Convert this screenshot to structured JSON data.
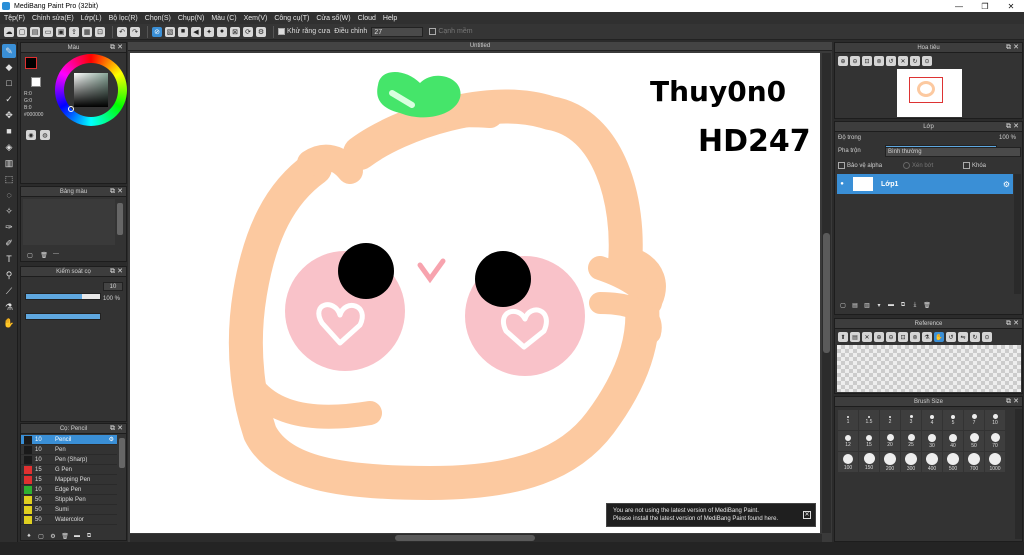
{
  "window": {
    "title": "MediBang Paint Pro (32bit)",
    "minimize": "—",
    "maximize": "❐",
    "close": "✕"
  },
  "menu": [
    "Tệp(F)",
    "Chỉnh sửa(E)",
    "Lớp(L)",
    "Bộ lọc(R)",
    "Chọn(S)",
    "Chụp(N)",
    "Màu (C)",
    "Xem(V)",
    "Công cụ(T)",
    "Cửa sổ(W)",
    "Cloud",
    "Help"
  ],
  "toolbar": {
    "antialias_label": "Khử răng cưa",
    "adjust_label": "Điều chỉnh",
    "adjust_value": "27",
    "smooth_label": "Cạnh mềm"
  },
  "canvas": {
    "tab_title": "Untitled",
    "signature_line1": "Thuy0n0",
    "signature_line2": "HD247"
  },
  "color_panel": {
    "title": "Màu",
    "r": "R:0",
    "g": "G:0",
    "b": "B:0",
    "hex": "#000000"
  },
  "palette_panel": {
    "title": "Bảng màu",
    "dash": "---"
  },
  "brush_control": {
    "title": "Kiểm soát cọ",
    "size_value": "10",
    "size_fraction": 0.75,
    "opacity_value": "100 %",
    "opacity_fraction": 1.0
  },
  "brush_panel": {
    "title": "Cọ: Pencil",
    "items": [
      {
        "size": "10",
        "name": "Pencil",
        "color": "#1a1a1a",
        "selected": true
      },
      {
        "size": "10",
        "name": "Pen",
        "color": "#1a1a1a",
        "selected": false
      },
      {
        "size": "10",
        "name": "Pen (Sharp)",
        "color": "#1a1a1a",
        "selected": false
      },
      {
        "size": "15",
        "name": "G Pen",
        "color": "#e03030",
        "selected": false
      },
      {
        "size": "15",
        "name": "Mapping Pen",
        "color": "#e03030",
        "selected": false
      },
      {
        "size": "10",
        "name": "Edge Pen",
        "color": "#30b030",
        "selected": false
      },
      {
        "size": "50",
        "name": "Stipple Pen",
        "color": "#e0d020",
        "selected": false
      },
      {
        "size": "50",
        "name": "Sumi",
        "color": "#e0d020",
        "selected": false
      },
      {
        "size": "50",
        "name": "Watercolor",
        "color": "#e0d020",
        "selected": false
      }
    ]
  },
  "navigator": {
    "title": "Hoa tiêu"
  },
  "layers": {
    "title": "Lớp",
    "opacity_label": "Độ trong",
    "opacity_value": "100 %",
    "blend_label": "Pha trộn",
    "blend_value": "Bình thường",
    "protect_alpha": "Bảo vệ alpha",
    "clipping": "Xén bớt",
    "lock": "Khóa",
    "layer_name": "Lớp1"
  },
  "reference": {
    "title": "Reference"
  },
  "brush_size": {
    "title": "Brush Size",
    "sizes": [
      "1",
      "1.5",
      "2",
      "3",
      "4",
      "5",
      "7",
      "10",
      "12",
      "15",
      "20",
      "25",
      "30",
      "40",
      "50",
      "70",
      "100",
      "150",
      "200",
      "300",
      "400",
      "500",
      "700",
      "1000"
    ]
  },
  "notice": {
    "line1": "You are not using the latest version of MediBang Paint.",
    "line2": "Please install the latest version of MediBang Paint found here."
  },
  "colors": {
    "accent": "#3a8fd6",
    "peach": "#fcc9a0",
    "blush": "#f9c2c9",
    "leaf": "#45e56a"
  }
}
